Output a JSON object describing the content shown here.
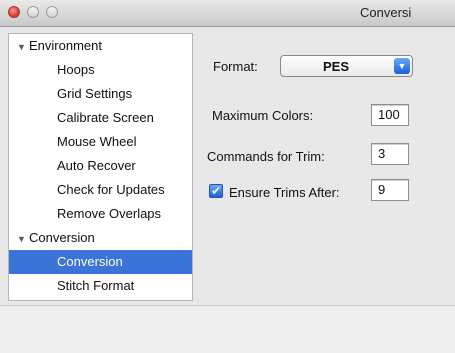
{
  "window": {
    "title": "Conversi",
    "close_light": "close-light",
    "minimize_light": "minimize-light",
    "zoom_light": "zoom-light"
  },
  "sidebar": {
    "disclosure_icon": "▼",
    "environment": {
      "label": "Environment",
      "items": [
        "Hoops",
        "Grid Settings",
        "Calibrate Screen",
        "Mouse Wheel",
        "Auto Recover",
        "Check for Updates",
        "Remove Overlaps"
      ]
    },
    "conversion": {
      "label": "Conversion",
      "items": [
        "Conversion",
        "Stitch Format"
      ]
    },
    "selected_item": "Conversion"
  },
  "form": {
    "format_label": "Format:",
    "format_value": "PES",
    "max_colors_label": "Maximum Colors:",
    "max_colors_value": "100",
    "commands_trim_label": "Commands for Trim:",
    "commands_trim_value": "3",
    "ensure_trims_label": "Ensure Trims After:",
    "ensure_trims_checked": true,
    "ensure_trims_value": "9",
    "dropdown_icon": "▼",
    "check_icon": "✔"
  },
  "colors": {
    "selection": "#3a74d6",
    "accent": "#1f5fd8"
  }
}
